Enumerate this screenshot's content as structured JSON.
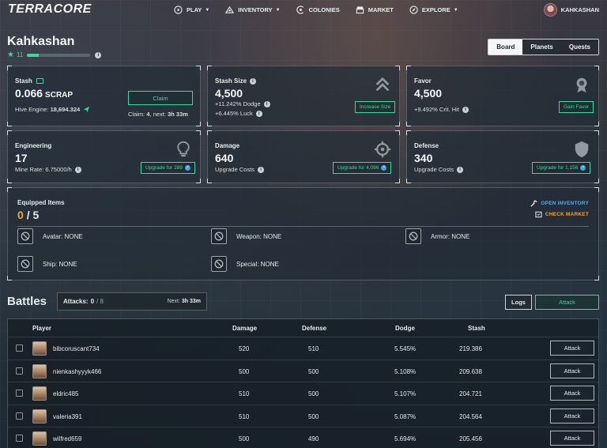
{
  "nav": {
    "logo": "TERRACORE",
    "items": [
      {
        "label": "PLAY",
        "icon": "play-icon",
        "caret": true
      },
      {
        "label": "INVENTORY",
        "icon": "inventory-icon",
        "caret": true
      },
      {
        "label": "COLONIES",
        "icon": "colonies-icon",
        "caret": false
      },
      {
        "label": "MARKET",
        "icon": "market-icon",
        "caret": false
      },
      {
        "label": "EXPLORE",
        "icon": "explore-icon",
        "caret": true
      }
    ],
    "username": "KAHKASHAN"
  },
  "profile": {
    "name": "Kahkashan",
    "level": "11",
    "xp_fraction": 0.18
  },
  "tabs": [
    {
      "label": "Board",
      "active": true
    },
    {
      "label": "Planets",
      "active": false
    },
    {
      "label": "Quests",
      "active": false
    }
  ],
  "stash": {
    "label": "Stash",
    "value": "0.066",
    "unit": "SCRAP",
    "hive_label": "Hive Engine:",
    "hive_value": "18,694.324",
    "button": "Claim",
    "claim_prefix": "Claim:",
    "claim_count": "4",
    "claim_next": ", next:",
    "claim_time": "3h 33m"
  },
  "stash_size": {
    "label": "Stash Size",
    "value": "4,500",
    "dodge_pct": "+11.242%",
    "dodge_label": "Dodge",
    "luck_pct": "+6.445%",
    "luck_label": "Luck",
    "button": "Increase Size"
  },
  "favor": {
    "label": "Favor",
    "value": "4,500",
    "crit_pct": "+9.492%",
    "crit_label": "Crit. Hit",
    "button": "Gain Favor"
  },
  "engineering": {
    "label": "Engineering",
    "value": "17",
    "rate_label": "Mine Rate:",
    "rate_value": "6.75000/h",
    "button": "Upgrade for 289"
  },
  "damage": {
    "label": "Damage",
    "value": "640",
    "sub": "Upgrade Costs",
    "button": "Upgrade for 4,096"
  },
  "defense": {
    "label": "Defense",
    "value": "340",
    "sub": "Upgrade Costs",
    "button": "Upgrade for 1,156"
  },
  "equipped": {
    "title": "Equipped Items",
    "current": "0",
    "separator": "/",
    "total": "5",
    "open_inventory": "OPEN INVENTORY",
    "check_market": "CHECK MARKET",
    "slots": [
      {
        "label": "Avatar:",
        "value": "NONE"
      },
      {
        "label": "Weapon:",
        "value": "NONE"
      },
      {
        "label": "Armor:",
        "value": "NONE"
      },
      {
        "label": "Ship:",
        "value": "NONE"
      },
      {
        "label": "Special:",
        "value": "NONE"
      }
    ]
  },
  "battles": {
    "title": "Battles",
    "attacks_label": "Attacks:",
    "attacks_current": "0",
    "attacks_total": "/ 8",
    "next_label": "Next:",
    "next_time": "3h 33m",
    "logs": "Logs",
    "attack": "Attack",
    "columns": [
      "Player",
      "Damage",
      "Defense",
      "Dodge",
      "Stash"
    ],
    "rows": [
      {
        "player": "bibcoruscant734",
        "damage": "520",
        "defense": "510",
        "dodge": "5.545%",
        "stash": "219.386",
        "action": "Attack"
      },
      {
        "player": "nienkashyyyk466",
        "damage": "500",
        "defense": "500",
        "dodge": "5.108%",
        "stash": "209.638",
        "action": "Attack"
      },
      {
        "player": "eldric485",
        "damage": "510",
        "defense": "500",
        "dodge": "5.107%",
        "stash": "204.721",
        "action": "Attack"
      },
      {
        "player": "valeria391",
        "damage": "510",
        "defense": "500",
        "dodge": "5.087%",
        "stash": "204.564",
        "action": "Attack"
      },
      {
        "player": "wilfred659",
        "damage": "500",
        "defense": "490",
        "dodge": "5.694%",
        "stash": "205.456",
        "action": "Attack"
      }
    ]
  },
  "colors": {
    "accent": "#3dd5a0",
    "orange": "#f0a23a",
    "link_blue": "#5aa8e6"
  }
}
